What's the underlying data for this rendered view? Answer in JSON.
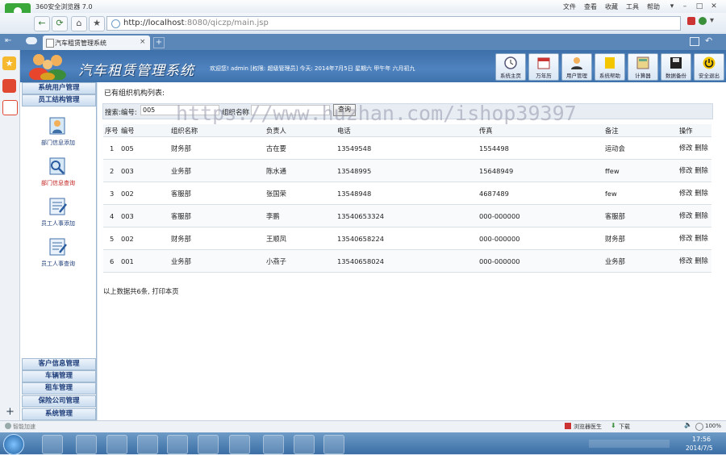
{
  "browser": {
    "title": "360安全浏览器 7.0",
    "menu": [
      "文件",
      "查看",
      "收藏",
      "工具",
      "帮助"
    ],
    "url_host": "http://localhost",
    "url_path": ":8080/qiczp/main.jsp",
    "tab_title": "汽车租赁管理系统",
    "tab_close": "×",
    "new_tab": "+"
  },
  "header": {
    "system_title": "汽车租赁管理系统",
    "welcome": "欢迎您! admin [权限: 超级管理员] 今天: 2014年7月5日 星期六 甲午年 六月初九",
    "tools": [
      {
        "label": "系统主页",
        "icon": "clock-icon"
      },
      {
        "label": "万年历",
        "icon": "calendar-icon"
      },
      {
        "label": "用户管理",
        "icon": "user-icon"
      },
      {
        "label": "系统帮助",
        "icon": "help-icon"
      },
      {
        "label": "计算器",
        "icon": "calculator-icon"
      },
      {
        "label": "数据备份",
        "icon": "floppy-icon"
      },
      {
        "label": "安全退出",
        "icon": "power-icon"
      }
    ]
  },
  "sidebar": {
    "top_sections": [
      "系统用户管理",
      "员工结构管理"
    ],
    "items": [
      {
        "label": "部门信息添加",
        "active": false
      },
      {
        "label": "部门信息查询",
        "active": true
      },
      {
        "label": "员工人事添加",
        "active": false
      },
      {
        "label": "员工人事查询",
        "active": false
      }
    ],
    "bottom_sections": [
      "客户信息管理",
      "车辆管理",
      "租车管理",
      "保险公司管理",
      "系统管理"
    ]
  },
  "main": {
    "list_title": "已有组织机构列表:",
    "search_label": "搜索:编号:",
    "search_value": "005",
    "org_label": "组织名称",
    "org_value": "",
    "query_button": "查询",
    "watermark": "https://www.huzhan.com/ishop39397",
    "columns": [
      "序号",
      "编号",
      "组织名称",
      "负责人",
      "电话",
      "传真",
      "备注",
      "操作"
    ],
    "rows": [
      [
        "1",
        "005",
        "财务部",
        "古在要",
        "13549548",
        "1554498",
        "运动会"
      ],
      [
        "2",
        "003",
        "业务部",
        "陈水通",
        "13548995",
        "15648949",
        "ffew"
      ],
      [
        "3",
        "002",
        "客服部",
        "张国荣",
        "13548948",
        "4687489",
        "few"
      ],
      [
        "4",
        "003",
        "客服部",
        "李鹏",
        "13540653324",
        "000-000000",
        "客服部"
      ],
      [
        "5",
        "002",
        "财务部",
        "王顺凤",
        "13540658224",
        "000-000000",
        "财务部"
      ],
      [
        "6",
        "001",
        "业务部",
        "小燕子",
        "13540658024",
        "000-000000",
        "业务部"
      ]
    ],
    "action_edit": "修改",
    "action_delete": "删除",
    "summary": "以上数据共6条, 打印本页"
  },
  "statusbar": {
    "left": "智能加速",
    "doctor": "浏览器医生",
    "download": "下载",
    "zoom": "100%"
  },
  "taskbar": {
    "time": "17:56",
    "date": "2014/7/5"
  }
}
